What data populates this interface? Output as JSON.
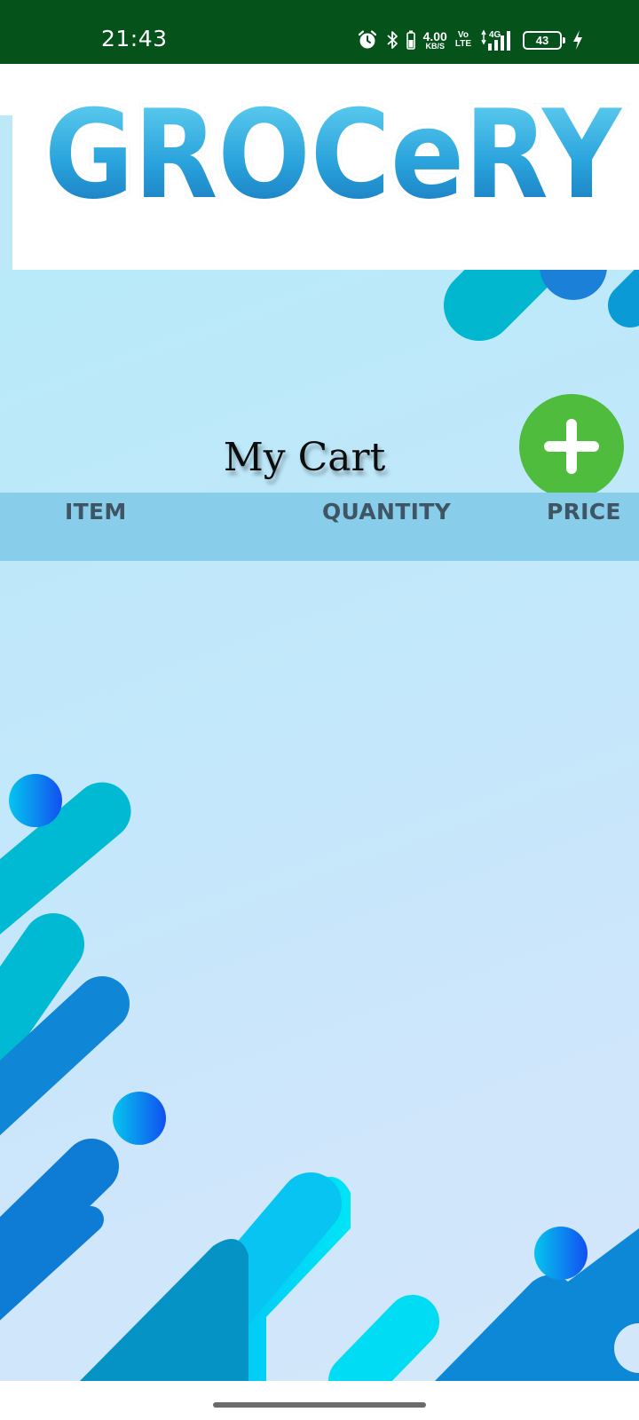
{
  "status_bar": {
    "time": "21:43",
    "net_speed_value": "4.00",
    "net_speed_unit": "KB/S",
    "volte_top": "Vo",
    "volte_bottom": "LTE",
    "network_type": "4G",
    "battery_level": "43",
    "icons": [
      "alarm-icon",
      "bluetooth-icon",
      "battery-saver-icon",
      "signal-icon",
      "battery-icon",
      "charging-icon"
    ]
  },
  "header": {
    "logo_text": "GROCeRY",
    "logo_colors": {
      "fill_top": "#5fd0f0",
      "fill_bottom": "#1a86c9",
      "outline": "#ffffff",
      "glow": "#2aa8d8"
    }
  },
  "cart": {
    "title": "My Cart",
    "add_button_icon": "plus-icon",
    "add_button_color": "#4fbc3d",
    "columns": [
      "ITEM",
      "QUANTITY",
      "PRICE"
    ],
    "rows": []
  },
  "colors": {
    "status_bar": "#05521a",
    "table_header": "#88cdea",
    "background": "#c4e7fb"
  }
}
